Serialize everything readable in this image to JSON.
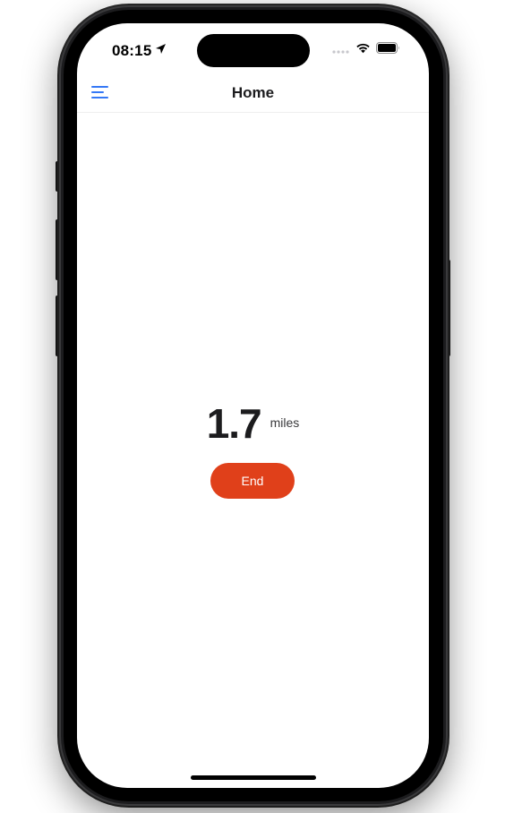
{
  "status_bar": {
    "time": "08:15",
    "icons": [
      "location-arrow-icon",
      "cellular-signal-icon",
      "wifi-icon",
      "battery-icon"
    ]
  },
  "nav": {
    "title": "Home",
    "menu_icon": "hamburger-menu-icon"
  },
  "main": {
    "distance_value": "1.7",
    "distance_unit": "miles",
    "end_label": "End"
  },
  "colors": {
    "accent_blue": "#3478f6",
    "end_button": "#e0401a",
    "text_primary": "#1c1c1e"
  }
}
